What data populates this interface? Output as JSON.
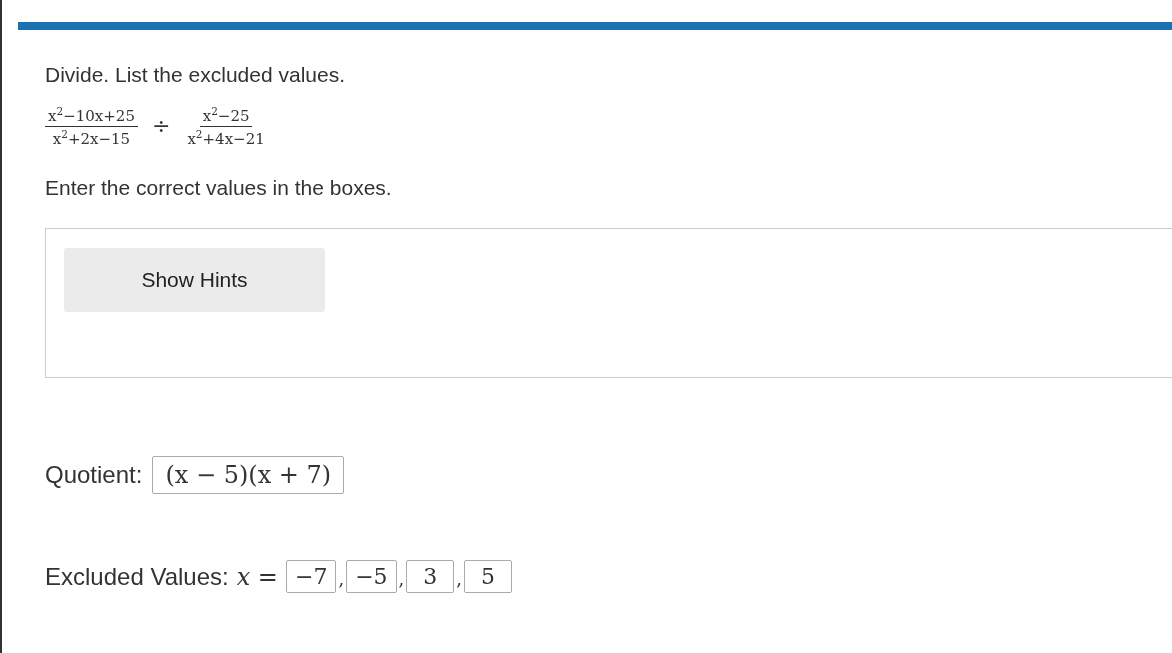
{
  "prompt": "Divide. List the excluded values.",
  "expression": {
    "left": {
      "numerator": "x$^{2}$−10x+25",
      "denominator": "x$^{2}$+2x−15"
    },
    "operator": "÷",
    "right": {
      "numerator": "x$^{2}$−25",
      "denominator": "x$^{2}$+4x−21"
    }
  },
  "instruction": "Enter the correct values in the boxes.",
  "hints_button": "Show Hints",
  "quotient": {
    "label": "Quotient:",
    "value": "(x − 5)(x + 7)"
  },
  "excluded": {
    "label": "Excluded Values:",
    "variable": "x =",
    "values": [
      "−7",
      "−5",
      "3",
      "5"
    ],
    "separator": ","
  }
}
